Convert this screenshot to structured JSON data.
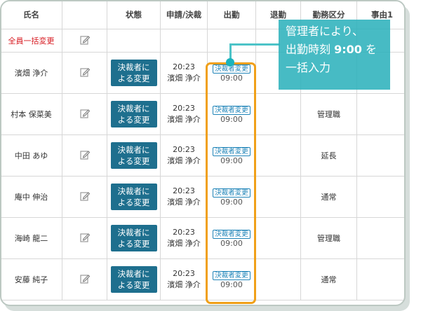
{
  "table": {
    "headers": [
      "氏名",
      "状態",
      "申請/決裁",
      "出勤",
      "退勤",
      "勤務区分",
      "事由1"
    ],
    "bulk_label": "全員一括変更",
    "rows": [
      {
        "name": "濱畑 浄介",
        "status": "決裁者による変更",
        "time": "20:23",
        "approver": "濱畑 浄介",
        "att_tag": "決裁者変更",
        "att_time": "09:00",
        "work_type": ""
      },
      {
        "name": "村本 保菜美",
        "status": "決裁者による変更",
        "time": "20:23",
        "approver": "濱畑 浄介",
        "att_tag": "決裁者変更",
        "att_time": "09:00",
        "work_type": "管理職"
      },
      {
        "name": "中田 あゆ",
        "status": "決裁者による変更",
        "time": "20:23",
        "approver": "濱畑 浄介",
        "att_tag": "決裁者変更",
        "att_time": "09:00",
        "work_type": "延長"
      },
      {
        "name": "庵中 伸治",
        "status": "決裁者による変更",
        "time": "20:23",
        "approver": "濱畑 浄介",
        "att_tag": "決裁者変更",
        "att_time": "09:00",
        "work_type": "通常"
      },
      {
        "name": "海崎 龍二",
        "status": "決裁者による変更",
        "time": "20:23",
        "approver": "濱畑 浄介",
        "att_tag": "決裁者変更",
        "att_time": "09:00",
        "work_type": "管理職"
      },
      {
        "name": "安藤 純子",
        "status": "決裁者による変更",
        "time": "20:23",
        "approver": "濱畑 浄介",
        "att_tag": "決裁者変更",
        "att_time": "09:00",
        "work_type": "通常"
      }
    ]
  },
  "callout": {
    "line1": "管理者により、",
    "line2_prefix": "出勤時刻 ",
    "line2_time": "9:00",
    "line2_suffix": " を",
    "line3": "一括入力"
  },
  "icons": {
    "edit": "pencil-edit-icon"
  },
  "colors": {
    "status_button": "#1e6f8e",
    "highlight": "#f0a019",
    "callout": "#2db2bc",
    "bulk_label": "#d71920"
  }
}
